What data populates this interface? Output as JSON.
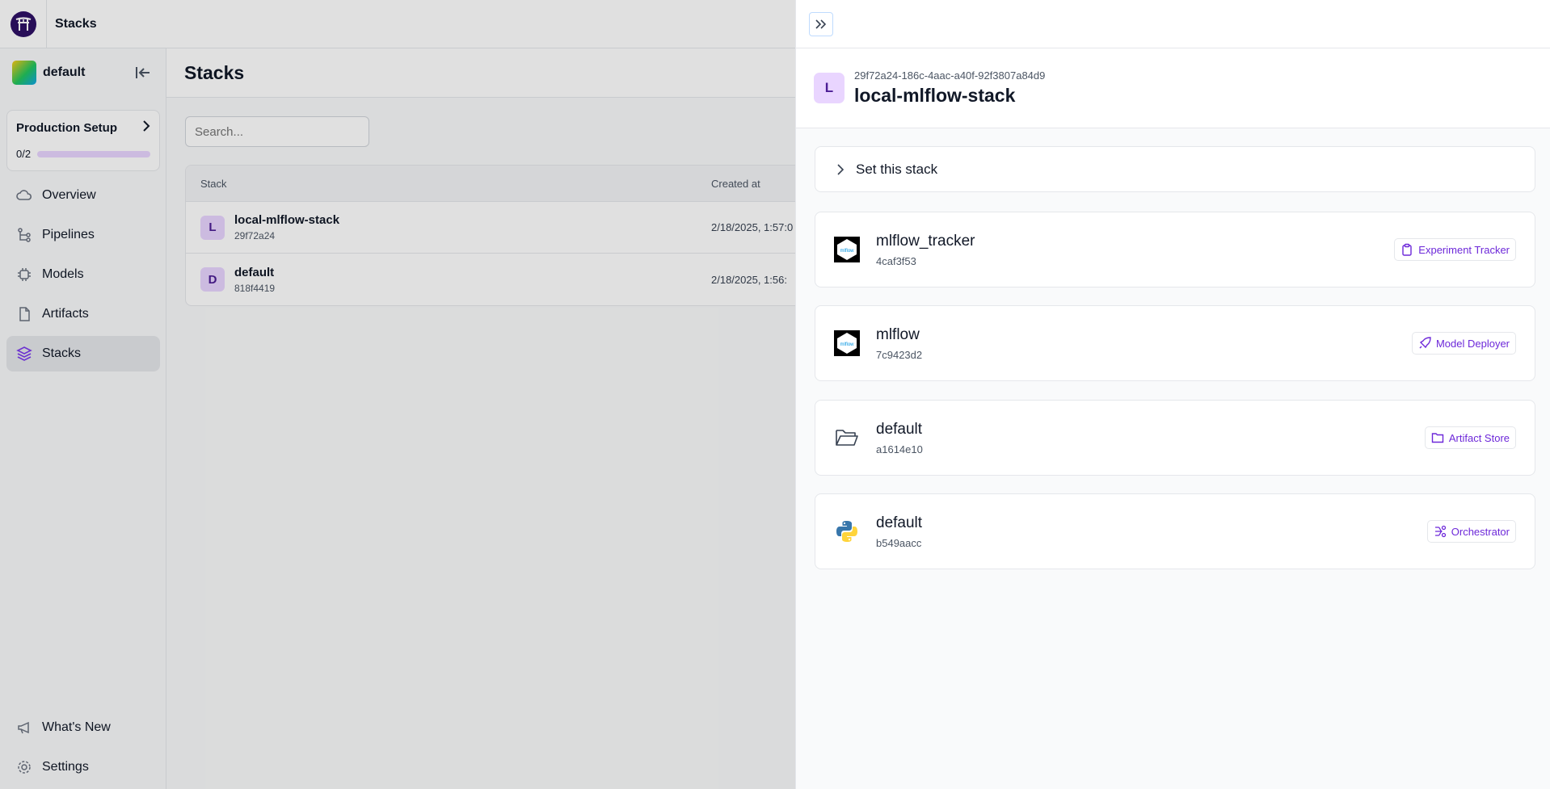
{
  "topbar": {
    "title": "Stacks"
  },
  "sidebar": {
    "workspace": "default",
    "production_setup": {
      "title": "Production Setup",
      "progress_text": "0/2",
      "progress": 0
    },
    "nav": [
      {
        "label": "Overview",
        "icon": "cloud-icon"
      },
      {
        "label": "Pipelines",
        "icon": "pipeline-icon"
      },
      {
        "label": "Models",
        "icon": "chip-icon"
      },
      {
        "label": "Artifacts",
        "icon": "file-icon"
      },
      {
        "label": "Stacks",
        "icon": "layers-icon"
      }
    ],
    "bottom": [
      {
        "label": "What's New",
        "icon": "megaphone-icon"
      },
      {
        "label": "Settings",
        "icon": "gear-icon"
      }
    ]
  },
  "main": {
    "title": "Stacks",
    "search_placeholder": "Search...",
    "columns": [
      "Stack",
      "Created at"
    ],
    "rows": [
      {
        "letter": "L",
        "name": "local-mlflow-stack",
        "id": "29f72a24",
        "created": "2/18/2025, 1:57:0"
      },
      {
        "letter": "D",
        "name": "default",
        "id": "818f4419",
        "created": "2/18/2025, 1:56:"
      }
    ]
  },
  "panel": {
    "letter": "L",
    "uuid": "29f72a24-186c-4aac-a40f-92f3807a84d9",
    "name": "local-mlflow-stack",
    "set_stack_label": "Set this stack",
    "components": [
      {
        "name": "mlflow_tracker",
        "id": "4caf3f53",
        "type": "Experiment Tracker",
        "icon": "mlflow-logo",
        "type_icon": "clipboard-icon"
      },
      {
        "name": "mlflow",
        "id": "7c9423d2",
        "type": "Model Deployer",
        "icon": "mlflow-logo",
        "type_icon": "rocket-icon"
      },
      {
        "name": "default",
        "id": "a1614e10",
        "type": "Artifact Store",
        "icon": "folder-open-icon",
        "type_icon": "folder-icon"
      },
      {
        "name": "default",
        "id": "b549aacc",
        "type": "Orchestrator",
        "icon": "python-logo",
        "type_icon": "orchestrator-icon"
      }
    ]
  }
}
